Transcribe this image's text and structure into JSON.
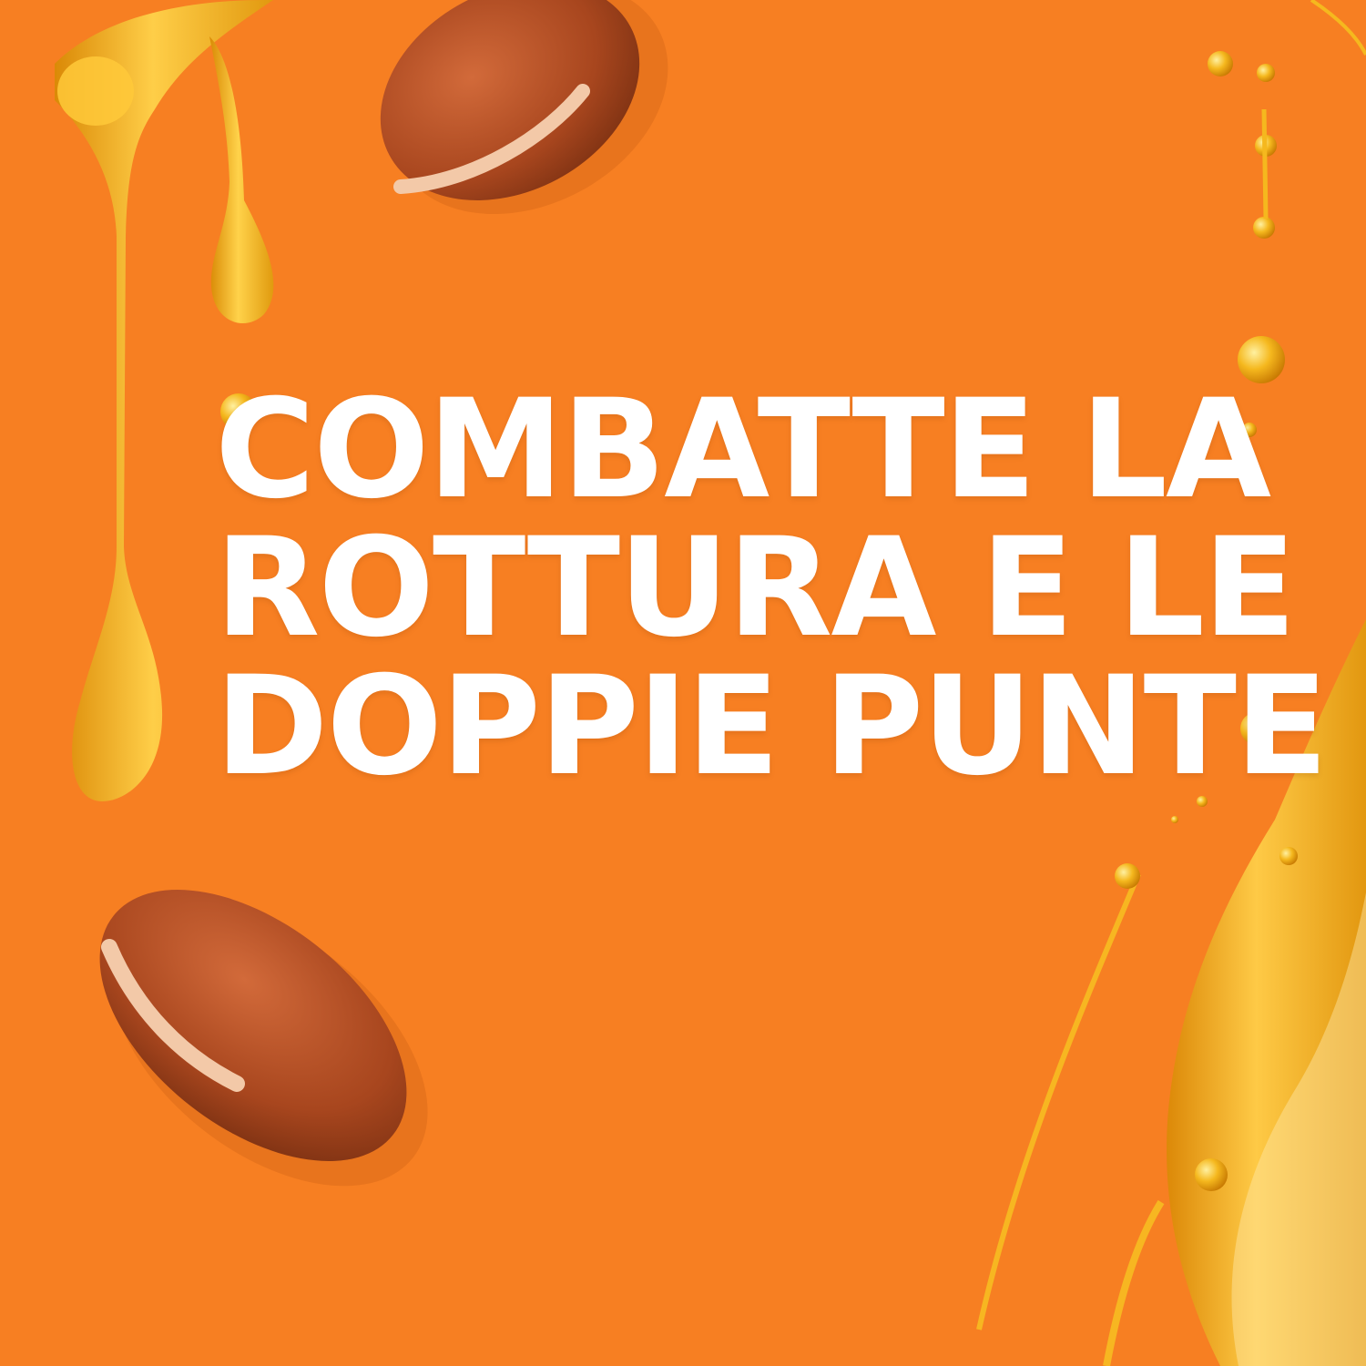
{
  "colors": {
    "background": "#F77F22",
    "headline_text": "#FFFFFF",
    "oil_gold": "#F2B01C",
    "seed_brown": "#A8461E"
  },
  "icons": [
    "oil-drip-icon",
    "argan-seed-icon",
    "oil-splash-icon"
  ],
  "headline": {
    "line1": "COMBATTE LA",
    "line2": "ROTTURA E LE",
    "line3": "DOPPIE PUNTE"
  }
}
